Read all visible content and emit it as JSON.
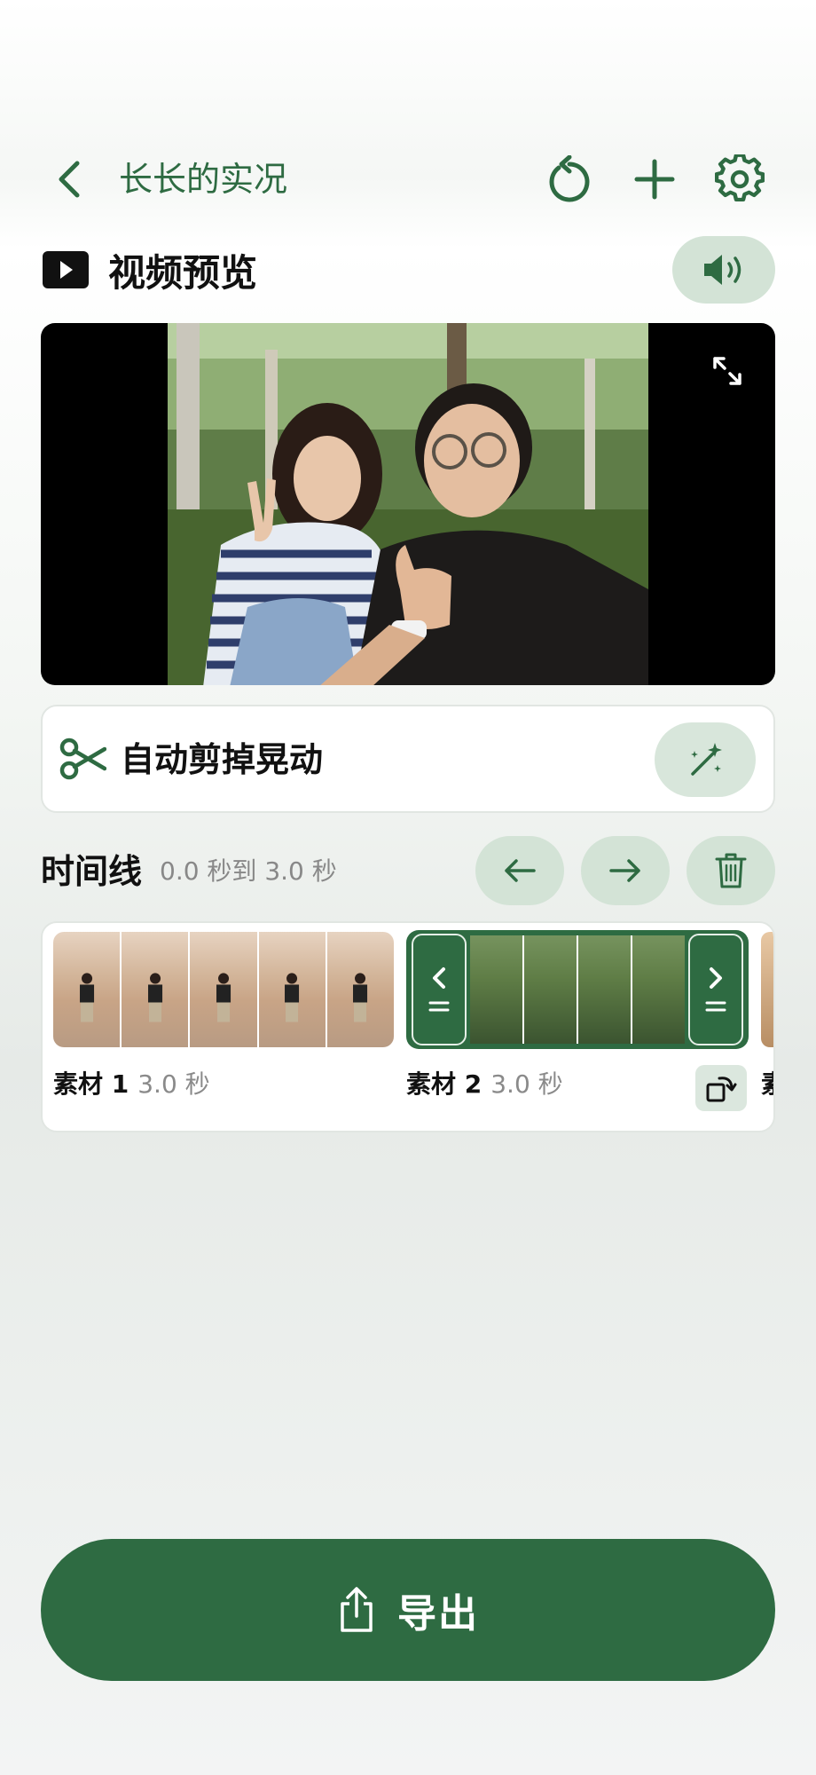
{
  "header": {
    "title": "长长的实况",
    "back_icon": "chevron-left-icon",
    "actions": [
      "undo-icon",
      "plus-icon",
      "gear-icon"
    ]
  },
  "preview": {
    "section_label": "视频预览",
    "sound_icon": "speaker-icon",
    "fullscreen_icon": "expand-icon"
  },
  "auto_cut": {
    "label": "自动剪掉晃动",
    "icon": "scissors-icon",
    "action_icon": "magic-wand-icon"
  },
  "timeline": {
    "title": "时间线",
    "range": "0.0 秒到 3.0 秒",
    "actions": [
      "arrow-left-icon",
      "arrow-right-icon",
      "trash-icon"
    ],
    "clips": [
      {
        "name": "素材 1",
        "duration": "3.0 秒"
      },
      {
        "name": "素材 2",
        "duration": "3.0 秒"
      },
      {
        "name": "素"
      }
    ]
  },
  "export": {
    "label": "导出",
    "icon": "share-icon"
  },
  "colors": {
    "accent": "#2e6b42",
    "accent_light": "#d3e3d6"
  }
}
